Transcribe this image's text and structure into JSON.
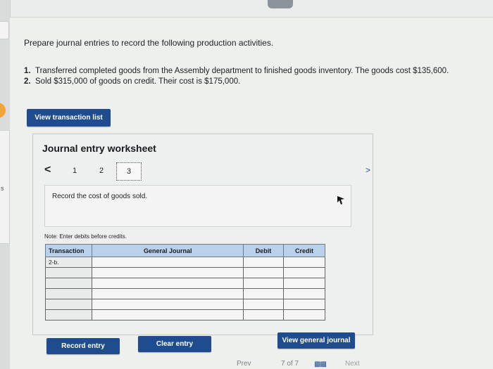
{
  "question": {
    "prompt": "Prepare journal entries to record the following production activities.",
    "items": [
      {
        "num": "1.",
        "text": "Transferred completed goods from the Assembly department to finished goods inventory. The goods cost $135,600."
      },
      {
        "num": "2.",
        "text": "Sold $315,000 of goods on credit. Their cost is $175,000."
      }
    ]
  },
  "buttons": {
    "view_transaction_list": "View transaction list",
    "record_entry": "Record entry",
    "clear_entry": "Clear entry",
    "view_general_journal": "View general journal"
  },
  "worksheet": {
    "title": "Journal entry worksheet",
    "pager": {
      "prev": "<",
      "pages": [
        "1",
        "2",
        "3"
      ],
      "current": "3",
      "next": ">"
    },
    "instruction": "Record the cost of goods sold.",
    "note": "Note: Enter debits before credits.",
    "table": {
      "headers": {
        "transaction": "Transaction",
        "general_journal": "General Journal",
        "debit": "Debit",
        "credit": "Credit"
      },
      "rows": [
        {
          "transaction": "2-b.",
          "account": "",
          "debit": "",
          "credit": ""
        },
        {
          "transaction": "",
          "account": "",
          "debit": "",
          "credit": ""
        },
        {
          "transaction": "",
          "account": "",
          "debit": "",
          "credit": ""
        },
        {
          "transaction": "",
          "account": "",
          "debit": "",
          "credit": ""
        },
        {
          "transaction": "",
          "account": "",
          "debit": "",
          "credit": ""
        },
        {
          "transaction": "",
          "account": "",
          "debit": "",
          "credit": ""
        }
      ]
    }
  },
  "footer": {
    "prev": "Prev",
    "page_indicator": "7 of 7",
    "next": "Next"
  },
  "sidebar": {
    "fragment": "s"
  },
  "colors": {
    "primary_button": "#1f4c8f",
    "table_header": "#b9d1ea",
    "accent_tab": "#f0a53a"
  }
}
